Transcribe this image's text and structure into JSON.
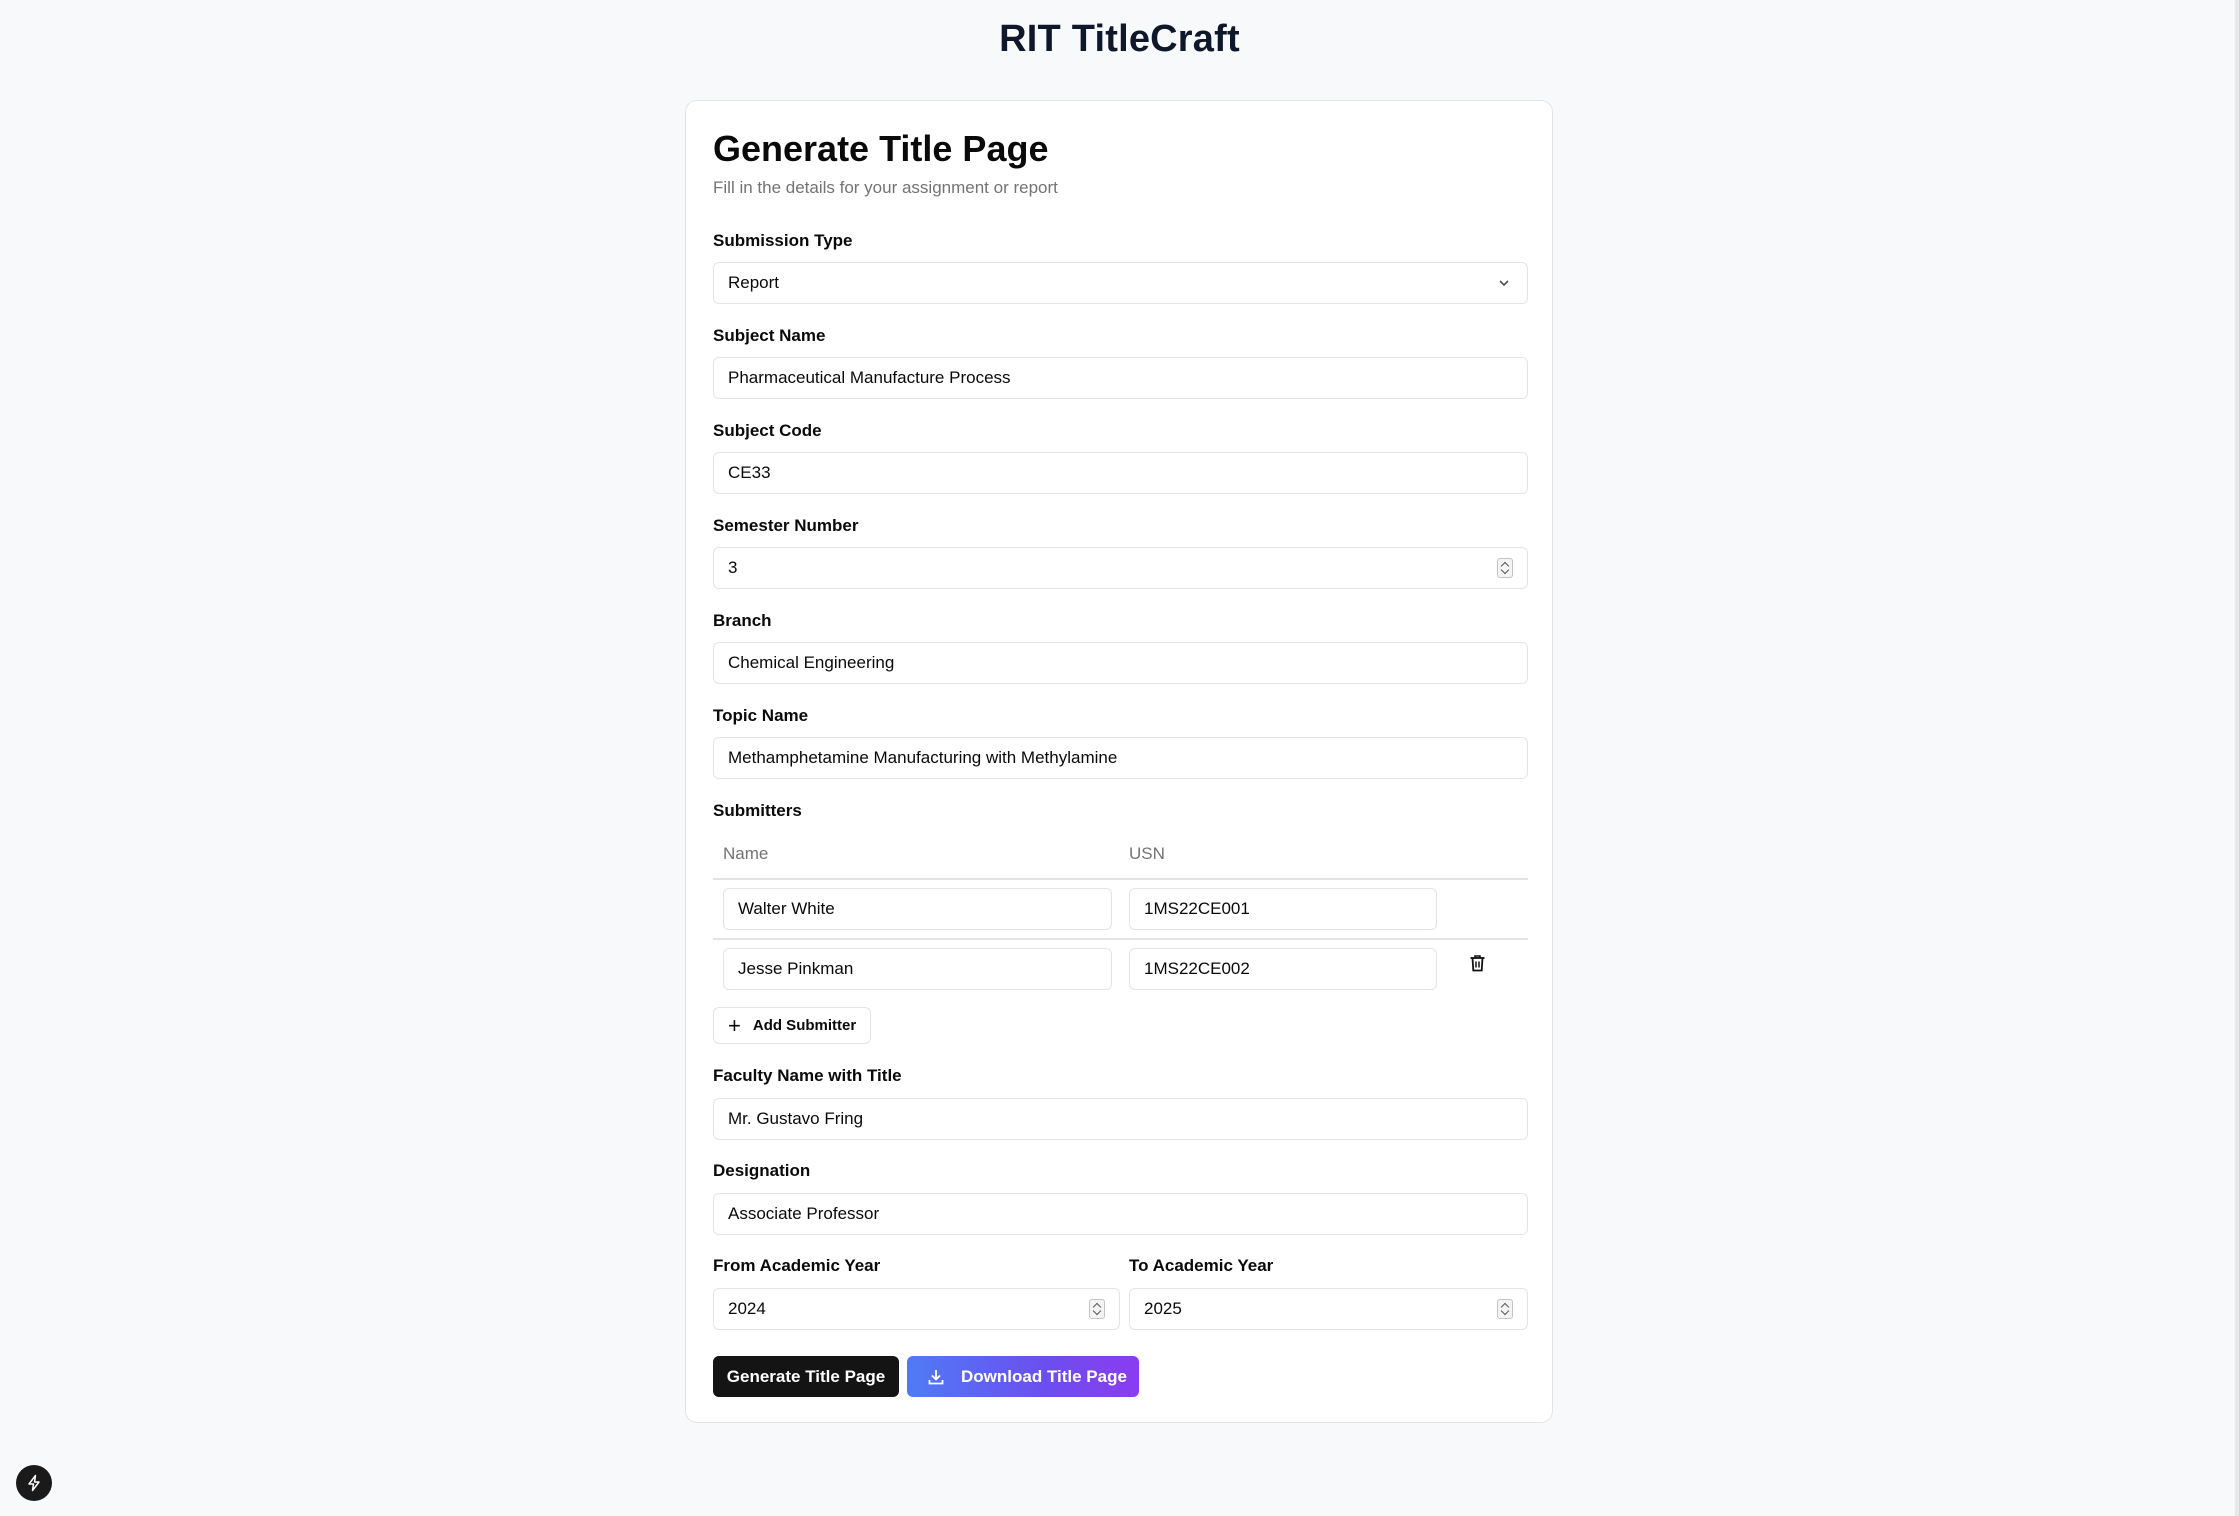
{
  "app_title": "RIT TitleCraft",
  "card": {
    "title": "Generate Title Page",
    "subtitle": "Fill in the details for your assignment or report"
  },
  "form": {
    "submission_type": {
      "label": "Submission Type",
      "value": "Report"
    },
    "subject_name": {
      "label": "Subject Name",
      "value": "Pharmaceutical Manufacture Process"
    },
    "subject_code": {
      "label": "Subject Code",
      "value": "CE33"
    },
    "semester_number": {
      "label": "Semester Number",
      "value": "3"
    },
    "branch": {
      "label": "Branch",
      "value": "Chemical Engineering"
    },
    "topic_name": {
      "label": "Topic Name",
      "value": "Methamphetamine Manufacturing with Methylamine"
    },
    "submitters": {
      "label": "Submitters",
      "columns": [
        "Name",
        "USN"
      ],
      "rows": [
        {
          "name": "Walter White",
          "usn": "1MS22CE001"
        },
        {
          "name": "Jesse Pinkman",
          "usn": "1MS22CE002"
        }
      ],
      "add_label": "Add Submitter"
    },
    "faculty_name": {
      "label": "Faculty Name with Title",
      "value": "Mr. Gustavo Fring"
    },
    "designation": {
      "label": "Designation",
      "value": "Associate Professor"
    },
    "from_year": {
      "label": "From Academic Year",
      "value": "2024"
    },
    "to_year": {
      "label": "To Academic Year",
      "value": "2025"
    }
  },
  "actions": {
    "generate_label": "Generate Title Page",
    "download_label": "Download Title Page"
  },
  "icons": {
    "chevron": "chevron-down-icon",
    "spinner": "stepper-icon",
    "trash": "trash-icon",
    "plus": "plus-icon",
    "download": "download-icon",
    "bolt": "bolt-icon"
  },
  "colors": {
    "primary_dark": "#141414",
    "gradient_start": "#4f7bf5",
    "gradient_end": "#8b3cf0",
    "muted_text": "#737373",
    "border": "#e4e4e7"
  }
}
